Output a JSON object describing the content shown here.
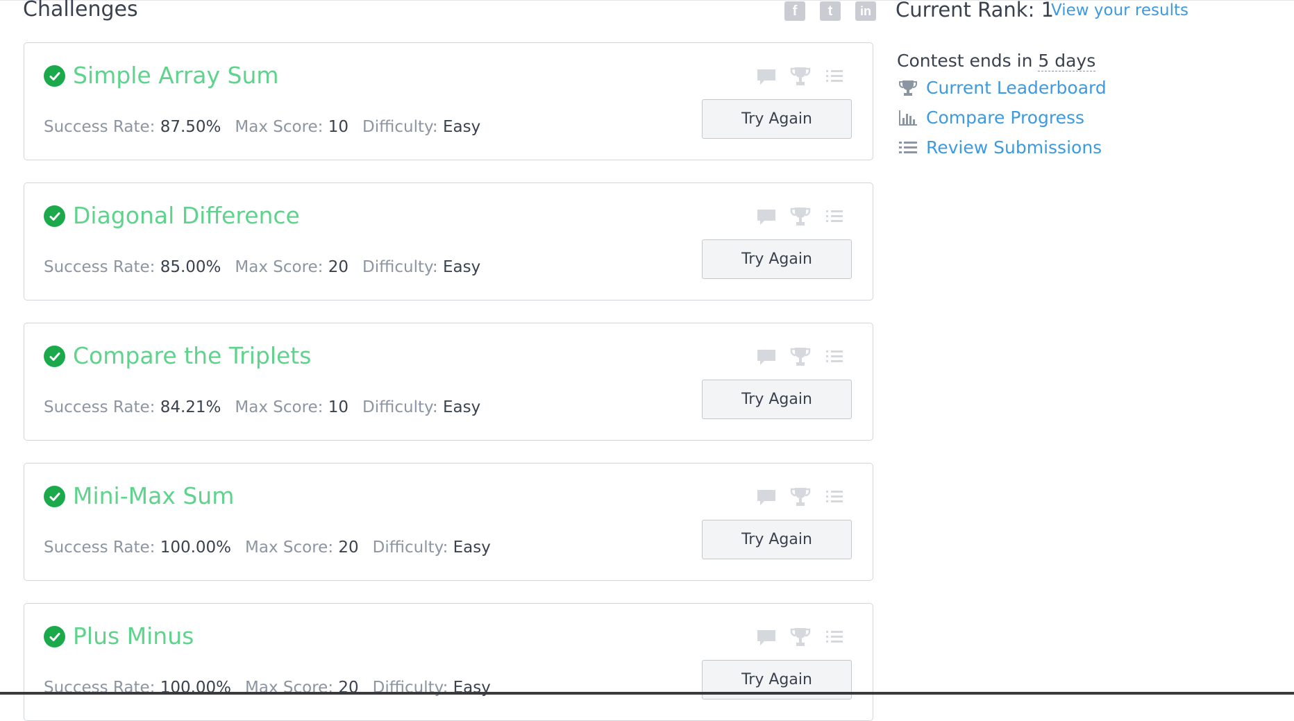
{
  "page": {
    "heading": "Challenges"
  },
  "header": {
    "social_icons": [
      "facebook-icon",
      "twitter-icon",
      "linkedin-icon"
    ],
    "social_glyphs": {
      "facebook": "f",
      "twitter": "t",
      "linkedin": "in"
    },
    "rank_label": "Current Rank: 1",
    "view_results_link": "View your results"
  },
  "stat_labels": {
    "success_rate": "Success Rate:",
    "max_score": "Max Score:",
    "difficulty": "Difficulty:"
  },
  "challenges": [
    {
      "title": "Simple Array Sum",
      "success_rate": "87.50%",
      "max_score": "10",
      "difficulty": "Easy",
      "action": "Try Again",
      "solved": true
    },
    {
      "title": "Diagonal Difference",
      "success_rate": "85.00%",
      "max_score": "20",
      "difficulty": "Easy",
      "action": "Try Again",
      "solved": true
    },
    {
      "title": "Compare the Triplets",
      "success_rate": "84.21%",
      "max_score": "10",
      "difficulty": "Easy",
      "action": "Try Again",
      "solved": true
    },
    {
      "title": "Mini-Max Sum",
      "success_rate": "100.00%",
      "max_score": "20",
      "difficulty": "Easy",
      "action": "Try Again",
      "solved": true
    },
    {
      "title": "Plus Minus",
      "success_rate": "100.00%",
      "max_score": "20",
      "difficulty": "Easy",
      "action": "Try Again",
      "solved": true
    }
  ],
  "sidebar": {
    "contest_prefix": "Contest ends in",
    "contest_days": "5 days",
    "links": [
      {
        "label": "Current Leaderboard",
        "icon": "trophy-icon"
      },
      {
        "label": "Compare Progress",
        "icon": "bar-chart-icon"
      },
      {
        "label": "Review Submissions",
        "icon": "list-icon"
      }
    ]
  },
  "colors": {
    "title_green": "#5fd38c",
    "check_green": "#1ba94c",
    "link_blue": "#3c9ae0",
    "icon_gray": "#d5d8dc"
  }
}
